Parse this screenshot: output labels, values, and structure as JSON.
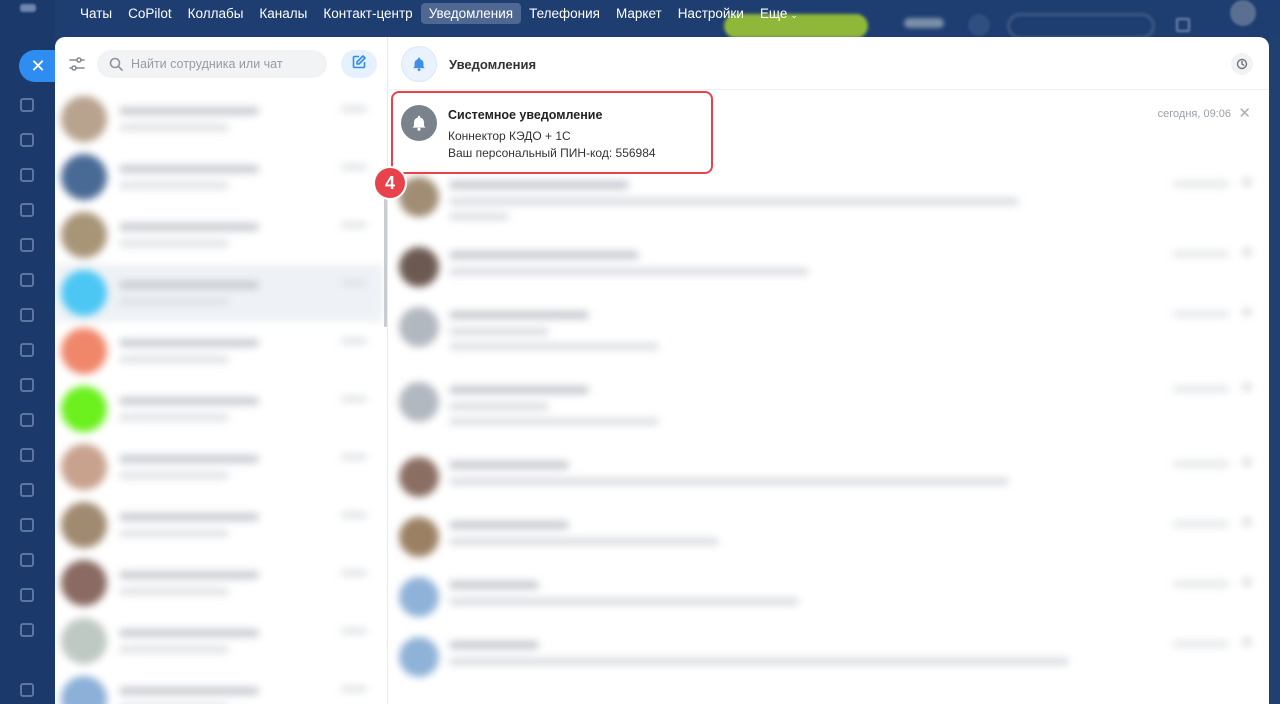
{
  "top_menu": {
    "items": [
      {
        "label": "Чаты",
        "active": false
      },
      {
        "label": "CoPilot",
        "active": false
      },
      {
        "label": "Коллабы",
        "active": false
      },
      {
        "label": "Каналы",
        "active": false
      },
      {
        "label": "Контакт-центр",
        "active": false
      },
      {
        "label": "Уведомления",
        "active": true
      },
      {
        "label": "Телефония",
        "active": false
      },
      {
        "label": "Маркет",
        "active": false
      },
      {
        "label": "Настройки",
        "active": false
      },
      {
        "label": "Еще",
        "active": false
      }
    ]
  },
  "close_button": {
    "icon": "close-icon",
    "label": "✕"
  },
  "sidebar": {
    "search": {
      "placeholder": "Найти сотрудника или чат"
    },
    "filter_icon": "filter-sliders-icon",
    "compose_icon": "compose-icon"
  },
  "notifications": {
    "header_title": "Уведомления",
    "header_icon": "bell-icon",
    "first": {
      "title": "Системное уведомление",
      "line1": "Коннектор КЭДО + 1С",
      "line2": "Ваш персональный ПИН-код: 556984",
      "time": "сегодня, 09:06"
    }
  },
  "annotation": {
    "step": "4",
    "color": "#e8434c"
  },
  "colors": {
    "accent": "#2f8cf0",
    "portal_bg": "#1d3b6e",
    "highlight": "#e8434c"
  }
}
